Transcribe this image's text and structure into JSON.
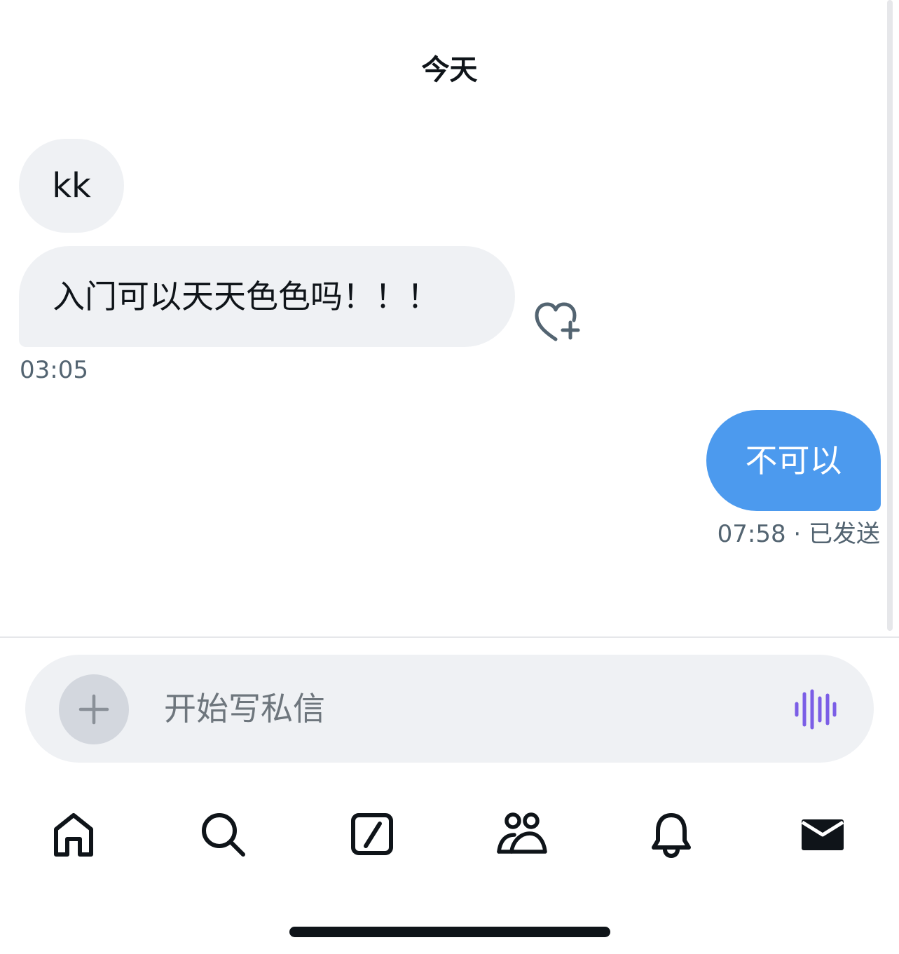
{
  "conversation": {
    "date_label": "今天",
    "messages": [
      {
        "text": "kk",
        "direction": "received"
      },
      {
        "text": "入门可以天天色色吗！！！",
        "direction": "received"
      },
      {
        "text": "不可以",
        "direction": "sent"
      }
    ],
    "received_time": "03:05",
    "sent_status": "07:58 · 已发送"
  },
  "composer": {
    "placeholder": "开始写私信",
    "add_icon": "plus-icon",
    "voice_icon": "voice-waveform-icon"
  },
  "tabbar": {
    "items": [
      {
        "icon": "home-icon"
      },
      {
        "icon": "search-icon"
      },
      {
        "icon": "compose-icon"
      },
      {
        "icon": "communities-icon"
      },
      {
        "icon": "bell-icon"
      },
      {
        "icon": "mail-icon",
        "active": true
      }
    ]
  },
  "colors": {
    "sent_bubble": "#4c9aee",
    "received_bubble": "#eff1f4",
    "voice_accent": "#7b5ee6",
    "text_primary": "#0f1419",
    "text_secondary": "#536471"
  }
}
